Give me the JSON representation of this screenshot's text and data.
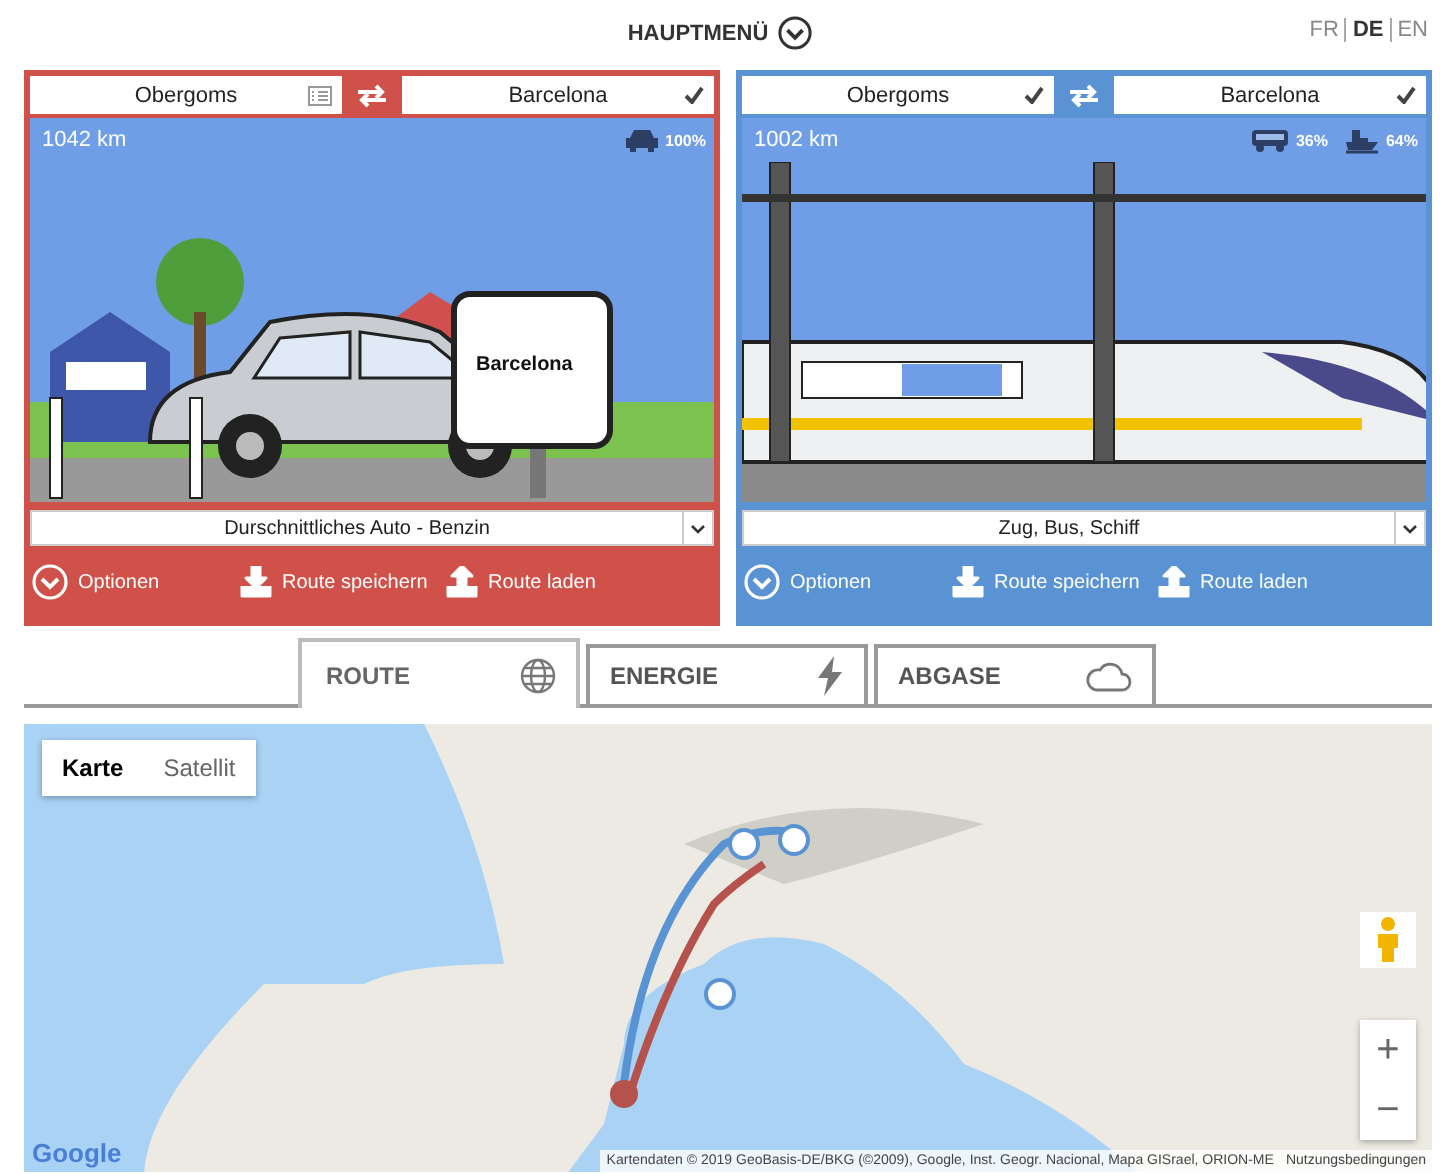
{
  "header": {
    "menu_label": "HAUPTMENÜ",
    "languages": [
      {
        "label": "FR",
        "selected": false
      },
      {
        "label": "DE",
        "selected": true
      },
      {
        "label": "EN",
        "selected": false
      }
    ]
  },
  "panels": [
    {
      "color": "#cf5149",
      "from": {
        "value": "Obergoms",
        "confirmed": false
      },
      "to": {
        "value": "Barcelona",
        "confirmed": true
      },
      "distance": "1042 km",
      "shares": [
        {
          "kind": "car",
          "reading": "100%"
        }
      ],
      "sign_text": "Barcelona",
      "vehicle": "Durschnittliches Auto - Benzin",
      "actions": [
        {
          "kind": "options",
          "label": "Optionen"
        },
        {
          "kind": "save",
          "label": "Route speichern"
        },
        {
          "kind": "load",
          "label": "Route laden"
        }
      ]
    },
    {
      "color": "#5a93d3",
      "from": {
        "value": "Obergoms",
        "confirmed": true
      },
      "to": {
        "value": "Barcelona",
        "confirmed": true
      },
      "distance": "1002 km",
      "shares": [
        {
          "kind": "bus",
          "reading": "36%"
        },
        {
          "kind": "ship",
          "reading": "64%"
        }
      ],
      "vehicle": "Zug, Bus, Schiff",
      "actions": [
        {
          "kind": "options",
          "label": "Optionen"
        },
        {
          "kind": "save",
          "label": "Route speichern"
        },
        {
          "kind": "load",
          "label": "Route laden"
        }
      ]
    }
  ],
  "tabs": [
    {
      "label": "ROUTE",
      "selected": true
    },
    {
      "label": "ENERGIE",
      "selected": false
    },
    {
      "label": "ABGASE",
      "selected": false
    }
  ],
  "map": {
    "map_types": [
      {
        "label": "Karte",
        "selected": true
      },
      {
        "label": "Satellit",
        "selected": false
      }
    ],
    "zoom": [
      "+",
      "−"
    ],
    "logo": "Google",
    "attribution": "Kartendaten © 2019 GeoBasis-DE/BKG (©2009), Google, Inst. Geogr. Nacional, Mapa GISrael, ORION-ME",
    "terms": "Nutzungsbedingungen"
  }
}
